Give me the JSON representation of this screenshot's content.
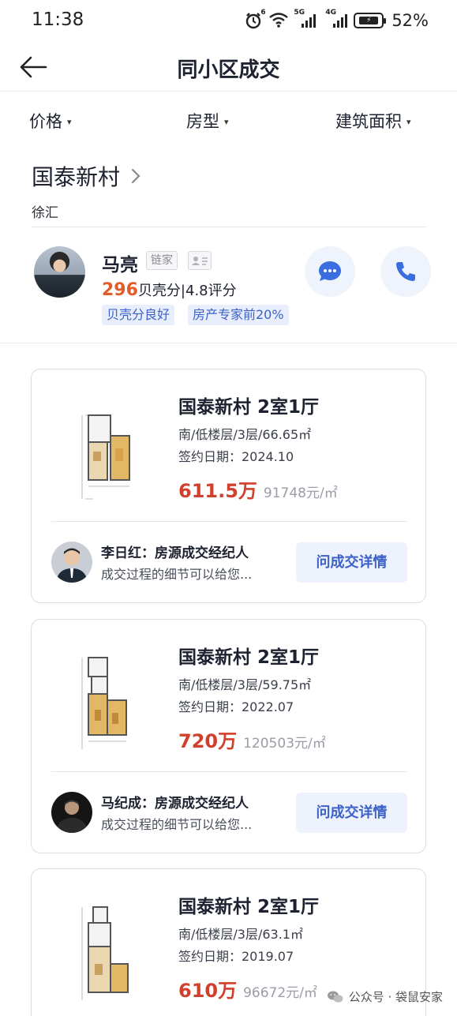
{
  "status_bar": {
    "time": "11:38",
    "battery_percent": "52%",
    "sig1_label": "6",
    "sig2_label": "5G",
    "sig3_label": "4G"
  },
  "nav": {
    "title": "同小区成交"
  },
  "filters": [
    {
      "label": "价格"
    },
    {
      "label": "房型"
    },
    {
      "label": "建筑面积"
    }
  ],
  "community": {
    "name": "国泰新村",
    "district": "徐汇"
  },
  "agent": {
    "name": "马亮",
    "company": "链家",
    "score_value": "296",
    "score_text": "贝壳分|4.8评分",
    "tags": [
      "贝壳分良好",
      "房产专家前20%"
    ]
  },
  "deals": [
    {
      "title": "国泰新村 2室1厅",
      "spec": "南/低楼层/3层/66.65㎡",
      "sign_date": "签约日期：2024.10",
      "total_price": "611.5万",
      "unit_price": "91748元/㎡",
      "broker_line": "李日红：房源成交经纪人",
      "broker_note": "成交过程的细节可以给您...",
      "button": "问成交详情"
    },
    {
      "title": "国泰新村 2室1厅",
      "spec": "南/低楼层/3层/59.75㎡",
      "sign_date": "签约日期：2022.07",
      "total_price": "720万",
      "unit_price": "120503元/㎡",
      "broker_line": "马纪成：房源成交经纪人",
      "broker_note": "成交过程的细节可以给您...",
      "button": "问成交详情"
    },
    {
      "title": "国泰新村 2室1厅",
      "spec": "南/低楼层/3层/63.1㎡",
      "sign_date": "签约日期：2019.07",
      "total_price": "610万",
      "unit_price": "96672元/㎡"
    }
  ],
  "watermark": "公众号 · 袋鼠安家",
  "colors": {
    "accent_blue": "#3c62c8",
    "price_red": "#d0402c",
    "score_orange": "#e25c2b"
  },
  "icons": [
    "back-arrow-icon",
    "chevron-right-icon",
    "chat-bubble-icon",
    "phone-icon",
    "id-card-icon",
    "wechat-icon"
  ]
}
